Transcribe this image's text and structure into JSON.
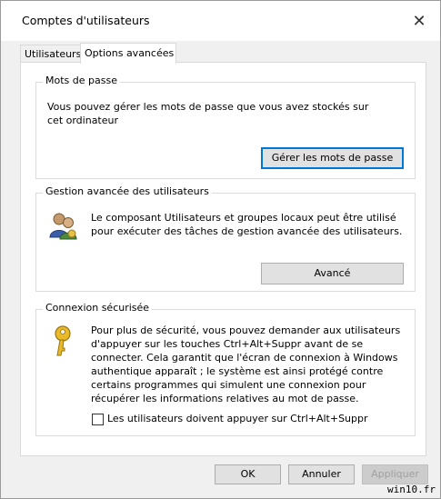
{
  "window": {
    "title": "Comptes d'utilisateurs",
    "close_glyph": "✕"
  },
  "tabs": [
    {
      "label": "Utilisateurs",
      "active": false
    },
    {
      "label": "Options avancées",
      "active": true
    }
  ],
  "passwords": {
    "title": "Mots de passe",
    "description": "Vous pouvez gérer les mots de passe que vous avez stockés sur cet ordinateur",
    "button": "Gérer les mots de passe"
  },
  "advanced": {
    "title": "Gestion avancée des utilisateurs",
    "description": "Le composant Utilisateurs et groupes locaux peut être utilisé pour exécuter des tâches de gestion avancée des utilisateurs.",
    "button": "Avancé",
    "icon": "users-icon"
  },
  "secure_logon": {
    "title": "Connexion sécurisée",
    "description": "Pour plus de sécurité, vous pouvez demander aux utilisateurs d'appuyer sur les touches Ctrl+Alt+Suppr avant de se connecter. Cela garantit que l'écran de connexion à Windows authentique apparaît ; le système est ainsi protégé contre certains programmes qui simulent une connexion pour récupérer les informations relatives au mot de passe.",
    "checkbox_label": "Les utilisateurs doivent appuyer sur Ctrl+Alt+Suppr",
    "checked": false,
    "icon": "key-icon"
  },
  "footer": {
    "ok": "OK",
    "cancel": "Annuler",
    "apply": "Appliquer"
  },
  "watermark": "win10.fr"
}
